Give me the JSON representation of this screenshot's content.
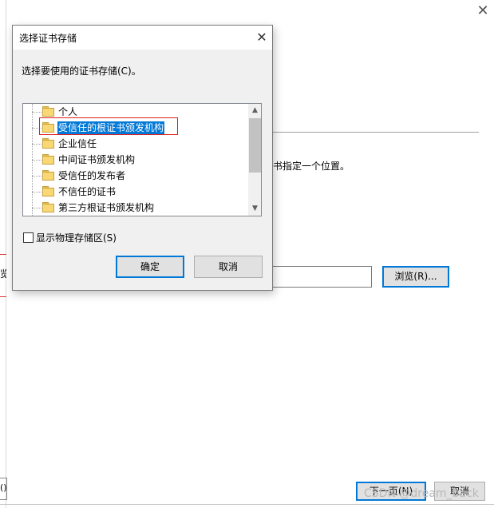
{
  "background": {
    "description": "书指定一个位置。",
    "browse_button": "浏览(R)...",
    "left_button_fragment": "览",
    "bottom_left_fragment": "()",
    "next_button": "下一页(N)",
    "cancel_button": "取消",
    "close_glyph": "✕"
  },
  "dialog": {
    "title": "选择证书存储",
    "close_glyph": "✕",
    "prompt": "选择要使用的证书存储(C)。",
    "tree": {
      "items": [
        {
          "label": "个人",
          "selected": false
        },
        {
          "label": "受信任的根证书颁发机构",
          "selected": true
        },
        {
          "label": "企业信任",
          "selected": false
        },
        {
          "label": "中间证书颁发机构",
          "selected": false
        },
        {
          "label": "受信任的发布者",
          "selected": false
        },
        {
          "label": "不信任的证书",
          "selected": false
        },
        {
          "label": "第三方根证书颁发机构",
          "selected": false
        }
      ],
      "item_icon": "folder-icon"
    },
    "checkbox": {
      "label": "显示物理存储区(S)",
      "checked": false
    },
    "ok_button": "确定",
    "cancel_button": "取消"
  },
  "watermark": "CSDN @dream_back",
  "colors": {
    "accent": "#0078d7",
    "highlight_border": "#e02020",
    "dialog_bg": "#f0f0f0"
  }
}
